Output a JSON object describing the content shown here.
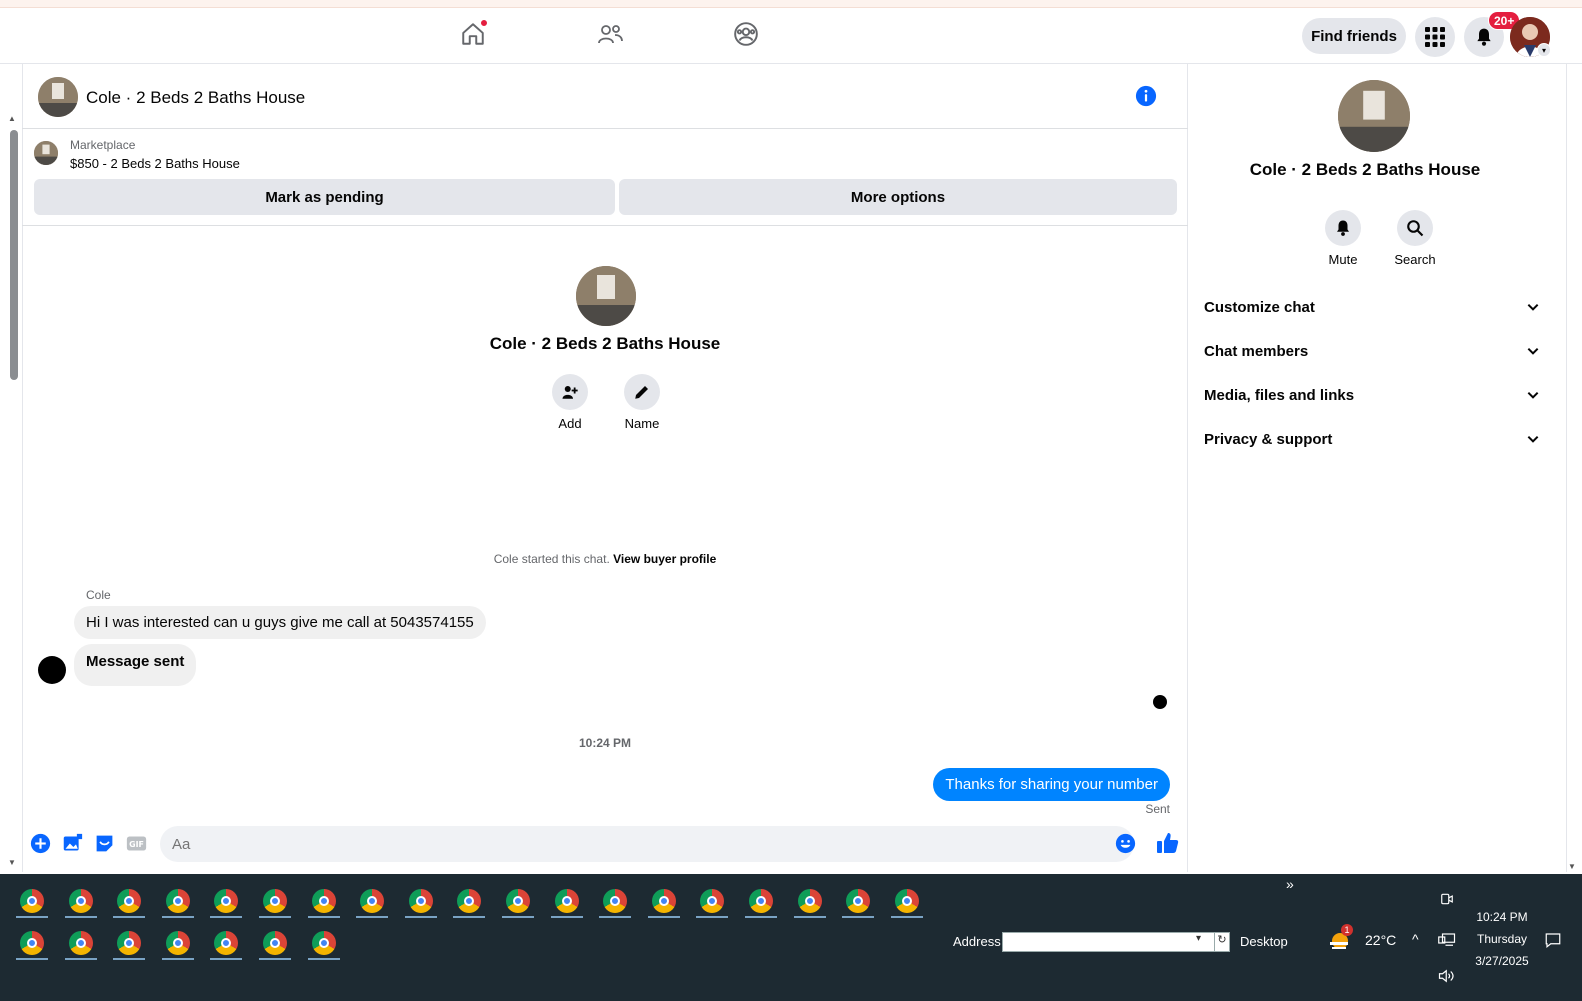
{
  "nav": {
    "find_friends": "Find friends",
    "notif_count": "20+"
  },
  "chat": {
    "title": "Cole · 2 Beds 2 Baths House",
    "marketplace_label": "Marketplace",
    "listing": "$850 - 2 Beds 2 Baths House",
    "mark_pending": "Mark as pending",
    "more_options": "More options",
    "center_title": "Cole · 2 Beds 2 Baths House",
    "add_label": "Add",
    "name_label": "Name",
    "started_text": "Cole started this chat.",
    "view_buyer": "View buyer profile",
    "sender": "Cole",
    "msg1": "Hi I was interested can u guys give me call at 5043574155",
    "msg2": "Message sent",
    "timestamp": "10:24 PM",
    "reply": "Thanks for sharing your number",
    "reply_status": "Sent",
    "composer_placeholder": "Aa"
  },
  "side": {
    "title": "Cole · 2 Beds 2 Baths House",
    "mute": "Mute",
    "search": "Search",
    "sections": [
      "Customize chat",
      "Chat members",
      "Media, files and links",
      "Privacy & support"
    ]
  },
  "taskbar": {
    "address_label": "Address",
    "desktop_label": "Desktop",
    "weather": "22°C",
    "weather_badge": "1",
    "time": "10:24 PM",
    "day": "Thursday",
    "date": "3/27/2025",
    "overflow": "»"
  },
  "colors": {
    "accent": "#0084ff",
    "badge": "#e41e3f",
    "taskbar": "#1d2a32"
  }
}
